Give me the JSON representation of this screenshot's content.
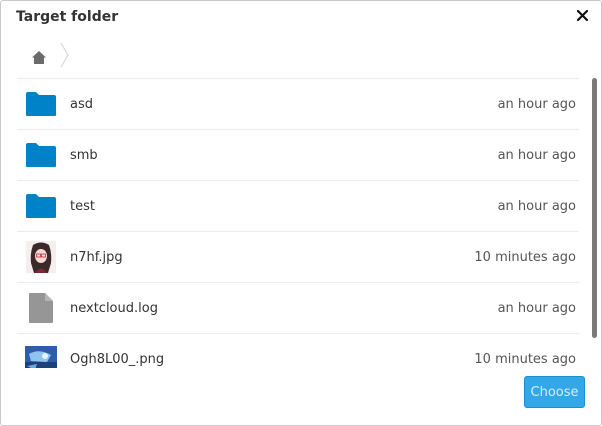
{
  "dialog": {
    "title": "Target folder",
    "close_icon": "close-icon",
    "choose_label": "Choose"
  },
  "breadcrumb": {
    "home_icon": "home-icon",
    "separator_icon": "chevron-right-icon"
  },
  "files": [
    {
      "name": "asd",
      "modified": "an hour ago",
      "icon": "folder-icon"
    },
    {
      "name": "smb",
      "modified": "an hour ago",
      "icon": "folder-icon"
    },
    {
      "name": "test",
      "modified": "an hour ago",
      "icon": "folder-icon"
    },
    {
      "name": "n7hf.jpg",
      "modified": "10 minutes ago",
      "icon": "image-thumbnail"
    },
    {
      "name": "nextcloud.log",
      "modified": "an hour ago",
      "icon": "file-icon"
    },
    {
      "name": "Ogh8L00_.png",
      "modified": "10 minutes ago",
      "icon": "image-thumbnail"
    }
  ],
  "colors": {
    "folder": "#0082c9",
    "accent_button": "#33a8e8",
    "file_gray": "#969696"
  }
}
